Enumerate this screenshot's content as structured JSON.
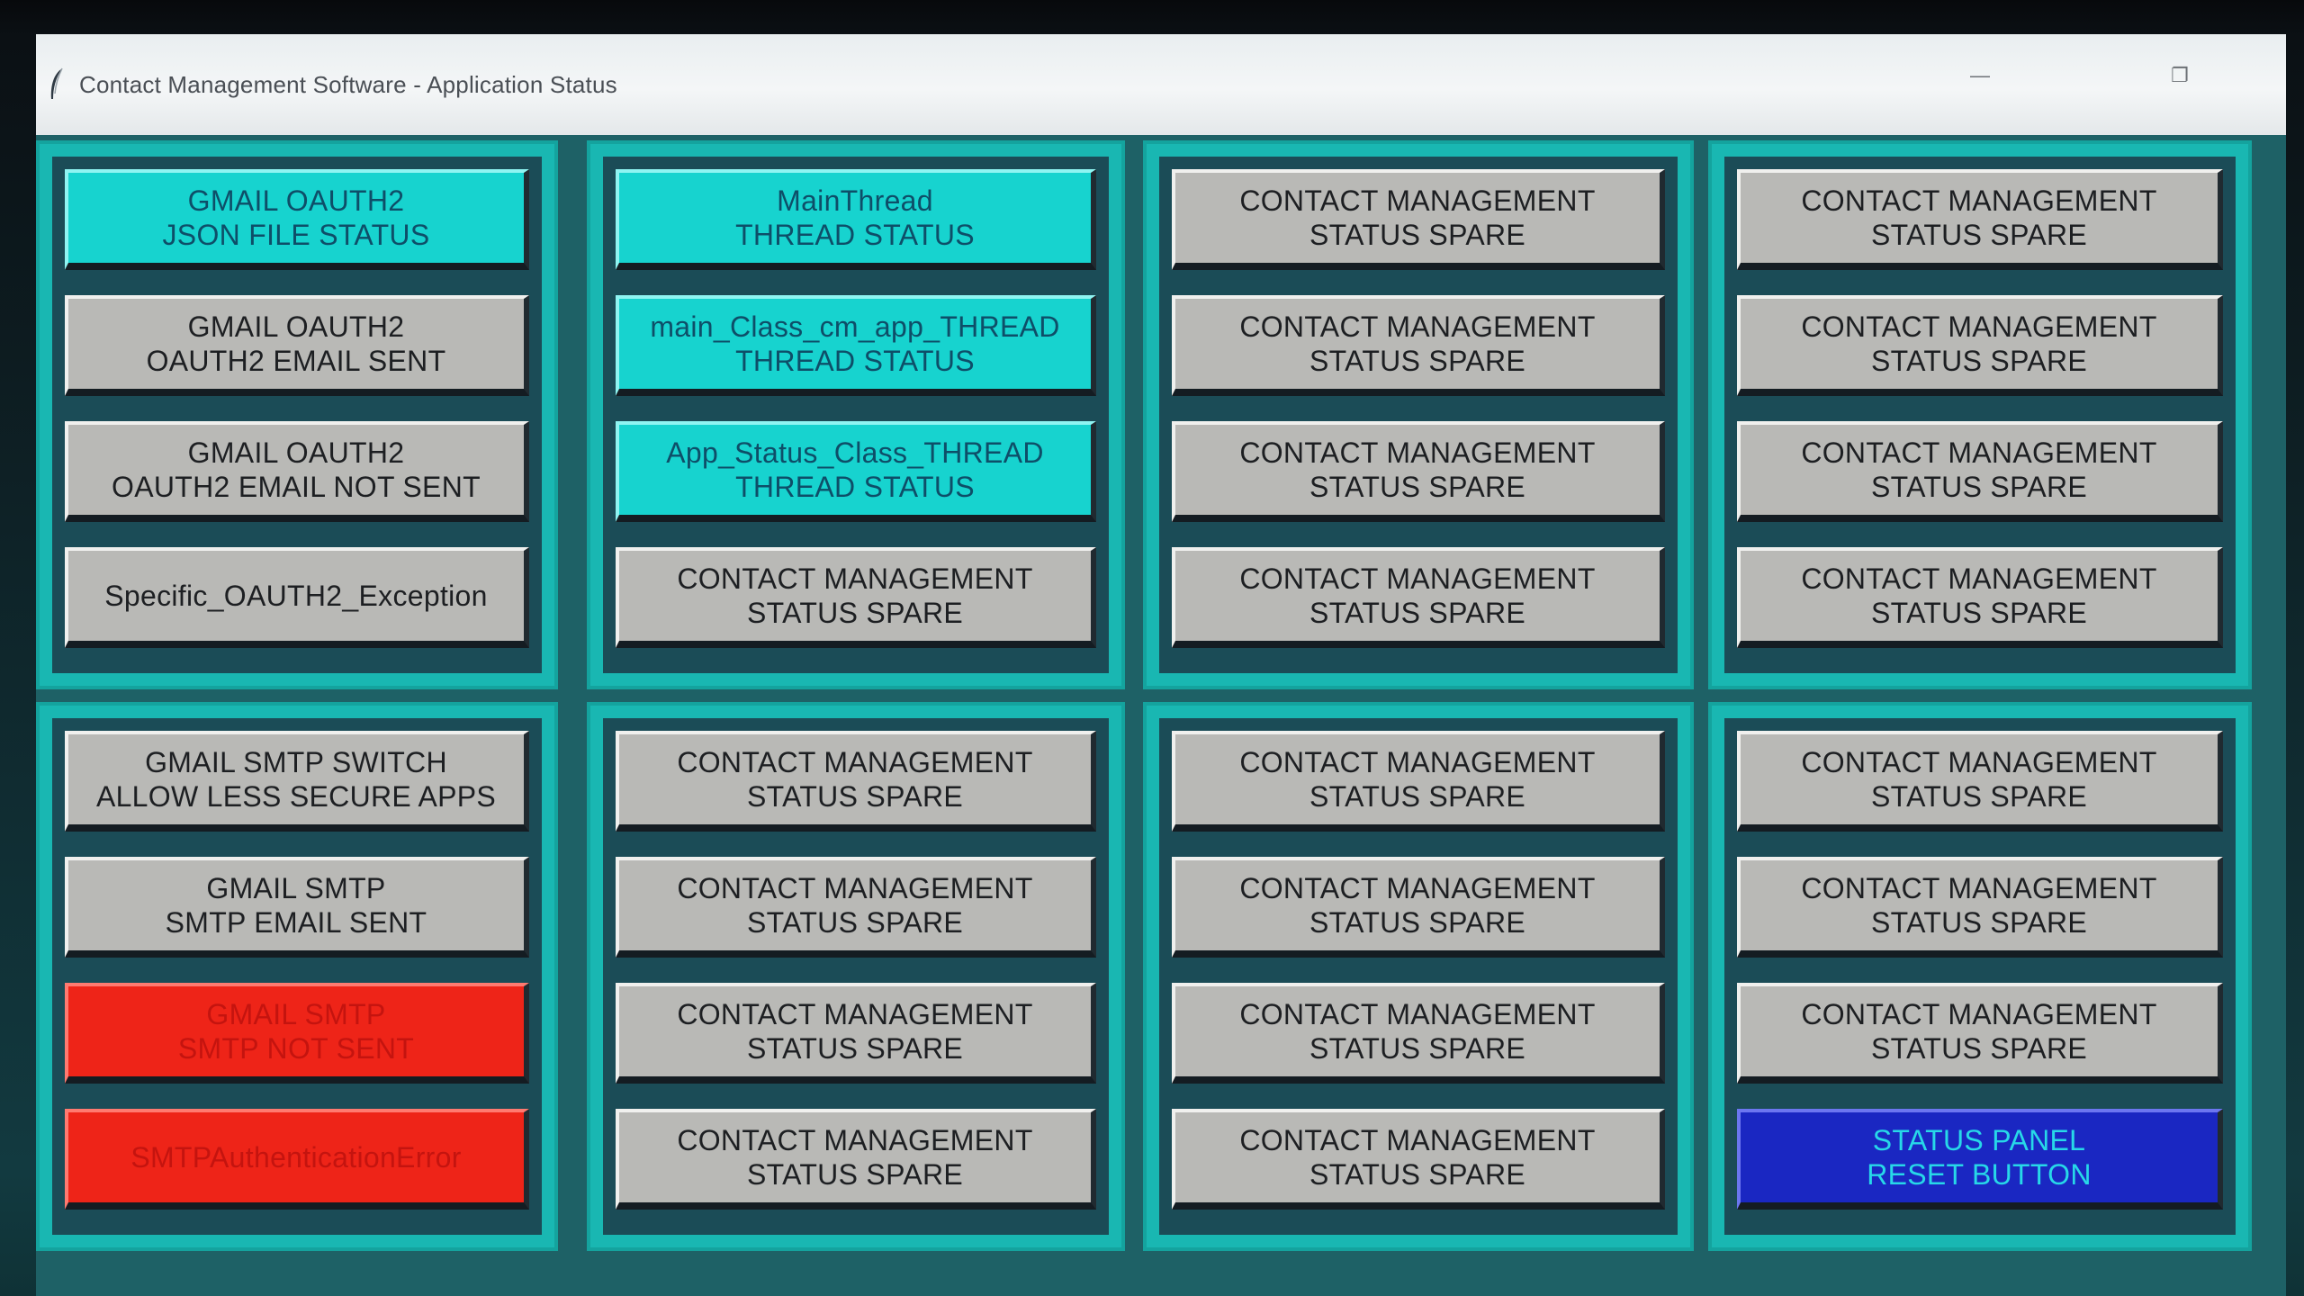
{
  "window": {
    "title": "Contact Management Software - Application Status",
    "icon": "feather-icon",
    "minimize_glyph": "—",
    "restore_glyph": "❐"
  },
  "colors": {
    "panel_border": "#19b7b2",
    "panel_bg": "#1b4c57",
    "button_gray": "#b9b9b6",
    "button_cyan": "#17d3cf",
    "button_red": "#ee2418",
    "button_blue": "#1a27c2"
  },
  "panels": [
    {
      "buttons": [
        {
          "label": "GMAIL OAUTH2\nJSON FILE STATUS",
          "state": "cyan"
        },
        {
          "label": "GMAIL OAUTH2\nOAUTH2 EMAIL SENT",
          "state": "gray"
        },
        {
          "label": "GMAIL OAUTH2\nOAUTH2 EMAIL NOT SENT",
          "state": "gray"
        },
        {
          "label": "Specific_OAUTH2_Exception",
          "state": "gray"
        }
      ]
    },
    {
      "buttons": [
        {
          "label": "MainThread\nTHREAD STATUS",
          "state": "cyan"
        },
        {
          "label": "main_Class_cm_app_THREAD\nTHREAD STATUS",
          "state": "cyan"
        },
        {
          "label": "App_Status_Class_THREAD\nTHREAD STATUS",
          "state": "cyan"
        },
        {
          "label": "CONTACT MANAGEMENT\nSTATUS SPARE",
          "state": "gray"
        }
      ]
    },
    {
      "buttons": [
        {
          "label": "CONTACT MANAGEMENT\nSTATUS SPARE",
          "state": "gray"
        },
        {
          "label": "CONTACT MANAGEMENT\nSTATUS SPARE",
          "state": "gray"
        },
        {
          "label": "CONTACT MANAGEMENT\nSTATUS SPARE",
          "state": "gray"
        },
        {
          "label": "CONTACT MANAGEMENT\nSTATUS SPARE",
          "state": "gray"
        }
      ]
    },
    {
      "buttons": [
        {
          "label": "CONTACT MANAGEMENT\nSTATUS SPARE",
          "state": "gray"
        },
        {
          "label": "CONTACT MANAGEMENT\nSTATUS SPARE",
          "state": "gray"
        },
        {
          "label": "CONTACT MANAGEMENT\nSTATUS SPARE",
          "state": "gray"
        },
        {
          "label": "CONTACT MANAGEMENT\nSTATUS SPARE",
          "state": "gray"
        }
      ]
    },
    {
      "buttons": [
        {
          "label": "GMAIL SMTP SWITCH\nALLOW LESS SECURE APPS",
          "state": "gray"
        },
        {
          "label": "GMAIL SMTP\nSMTP EMAIL SENT",
          "state": "gray"
        },
        {
          "label": "GMAIL SMTP\nSMTP NOT SENT",
          "state": "red"
        },
        {
          "label": "SMTPAuthenticationError",
          "state": "red"
        }
      ]
    },
    {
      "buttons": [
        {
          "label": "CONTACT MANAGEMENT\nSTATUS SPARE",
          "state": "gray"
        },
        {
          "label": "CONTACT MANAGEMENT\nSTATUS SPARE",
          "state": "gray"
        },
        {
          "label": "CONTACT MANAGEMENT\nSTATUS SPARE",
          "state": "gray"
        },
        {
          "label": "CONTACT MANAGEMENT\nSTATUS SPARE",
          "state": "gray"
        }
      ]
    },
    {
      "buttons": [
        {
          "label": "CONTACT MANAGEMENT\nSTATUS SPARE",
          "state": "gray"
        },
        {
          "label": "CONTACT MANAGEMENT\nSTATUS SPARE",
          "state": "gray"
        },
        {
          "label": "CONTACT MANAGEMENT\nSTATUS SPARE",
          "state": "gray"
        },
        {
          "label": "CONTACT MANAGEMENT\nSTATUS SPARE",
          "state": "gray"
        }
      ]
    },
    {
      "buttons": [
        {
          "label": "CONTACT MANAGEMENT\nSTATUS SPARE",
          "state": "gray"
        },
        {
          "label": "CONTACT MANAGEMENT\nSTATUS SPARE",
          "state": "gray"
        },
        {
          "label": "CONTACT MANAGEMENT\nSTATUS SPARE",
          "state": "gray"
        },
        {
          "label": "STATUS PANEL\nRESET BUTTON",
          "state": "blue"
        }
      ]
    }
  ]
}
